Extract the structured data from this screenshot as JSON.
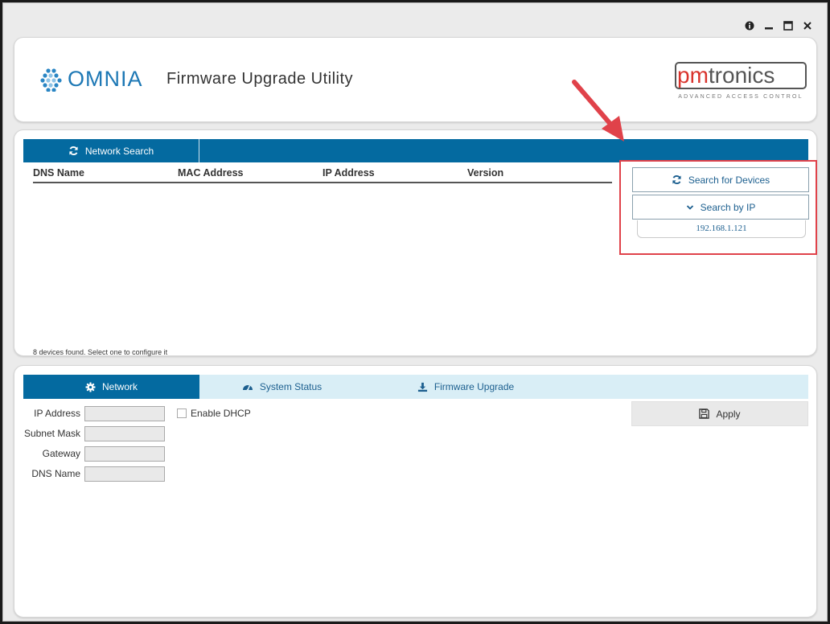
{
  "header": {
    "logo_text": "OMNIA",
    "app_title": "Firmware Upgrade Utility",
    "brand_pm": "pm",
    "brand_tronics": "tronics",
    "brand_tagline": "ADVANCED ACCESS CONTROL"
  },
  "window_controls": [
    {
      "name": "info-icon",
      "glyph": "i"
    },
    {
      "name": "minimize-icon",
      "glyph": "–"
    },
    {
      "name": "maximize-icon",
      "glyph": "□"
    },
    {
      "name": "close-icon",
      "glyph": "✕"
    }
  ],
  "network_search": {
    "tab_label": "Network Search",
    "columns": [
      "DNS Name",
      "MAC Address",
      "IP Address",
      "Version"
    ],
    "search_devices_label": "Search for Devices",
    "search_by_ip_label": "Search by IP",
    "ip_value": "192.168.1.121",
    "status": "8 devices found. Select one to configure it"
  },
  "config": {
    "tabs": [
      {
        "label": "Network",
        "icon": "gear-icon"
      },
      {
        "label": "System Status",
        "icon": "dashboard-icon"
      },
      {
        "label": "Firmware Upgrade",
        "icon": "download-icon"
      }
    ],
    "fields": [
      {
        "label": "IP Address",
        "value": ""
      },
      {
        "label": "Subnet Mask",
        "value": ""
      },
      {
        "label": "Gateway",
        "value": ""
      },
      {
        "label": "DNS Name",
        "value": ""
      }
    ],
    "dhcp_label": "Enable DHCP",
    "apply_label": "Apply"
  },
  "colors": {
    "primary": "#046aa0",
    "accent_red": "#e0424a",
    "tab_light": "#d9eef6"
  }
}
